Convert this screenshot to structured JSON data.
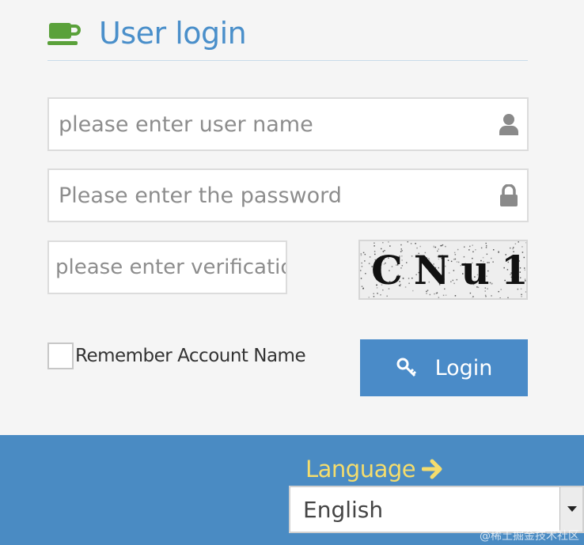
{
  "header": {
    "title": "User login",
    "icon": "coffee-cup-icon",
    "accent_color": "#4a8fca",
    "icon_color": "#5aa13a"
  },
  "form": {
    "username_placeholder": "please enter user name",
    "username_value": "",
    "username_icon": "user-icon",
    "password_placeholder": "Please enter the password",
    "password_value": "",
    "password_icon": "lock-icon",
    "verification_placeholder": "please enter verification code",
    "verification_value": "",
    "captcha_text": "CNu1",
    "remember_label": "Remember Account Name",
    "remember_checked": false,
    "login_label": "Login",
    "login_icon": "key-icon",
    "button_color": "#4a8bc8"
  },
  "footer": {
    "language_label": "Language",
    "language_arrow_icon": "arrow-right-icon",
    "language_selected": "English",
    "watermark": "@稀土掘金技术社区",
    "background_color": "#4a8bc3",
    "label_color": "#f5dd6c"
  }
}
